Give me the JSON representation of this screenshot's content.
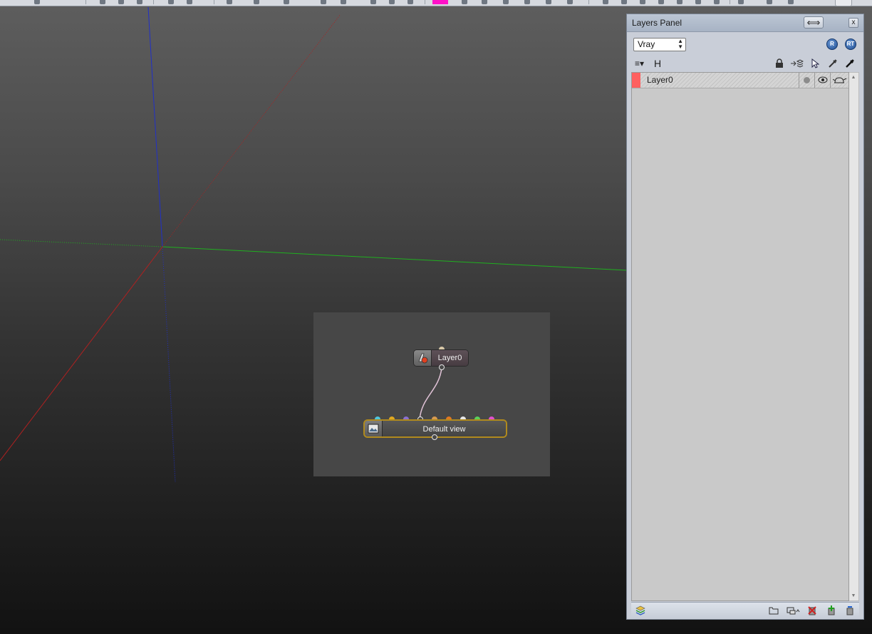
{
  "viewport": {
    "axes": {
      "x_axis_color": "#b02020",
      "y_axis_color": "#1fb01f",
      "z_axis_color": "#2030c8"
    },
    "node_graph": {
      "layer_node": {
        "label": "Layer0",
        "icon": "material-layer-icon"
      },
      "view_node": {
        "label": "Default view",
        "icon": "view-icon",
        "border_color": "#b08a1e"
      },
      "input_port_colors": [
        "#4fc6dc",
        "#e0a820",
        "#8a6fd0",
        "#ffffff",
        "#d89a50",
        "#e07820",
        "#e8e8e8",
        "#5ad05a",
        "#e050d0"
      ],
      "wire_color": "#e0c2d6"
    }
  },
  "toolbar": {
    "swatch_color": "#ff10c8"
  },
  "layers_panel": {
    "title": "Layers Panel",
    "dock_icon": "double-arrow-icon",
    "close_label": "x",
    "renderer": {
      "selected": "Vray"
    },
    "render_buttons": [
      {
        "label": "R",
        "icon": "vray-render-icon"
      },
      {
        "label": "RT",
        "icon": "vray-rt-icon"
      }
    ],
    "header": {
      "menu_icon": "list-menu-icon",
      "h_label": "H",
      "column_icons": [
        "lock-icon",
        "layers-move-icon",
        "select-cursor-icon",
        "eyedropper-icon",
        "eyedropper-dark-icon"
      ]
    },
    "layers": [
      {
        "name": "Layer0",
        "color": "#ff6060",
        "status_dot": "gray",
        "visible": true,
        "render": true
      }
    ],
    "footer_icons": [
      "layer-stack-icon",
      "folder-icon",
      "display-menu-icon",
      "delete-layer-icon",
      "add-layer-icon",
      "purge-layer-icon"
    ]
  }
}
